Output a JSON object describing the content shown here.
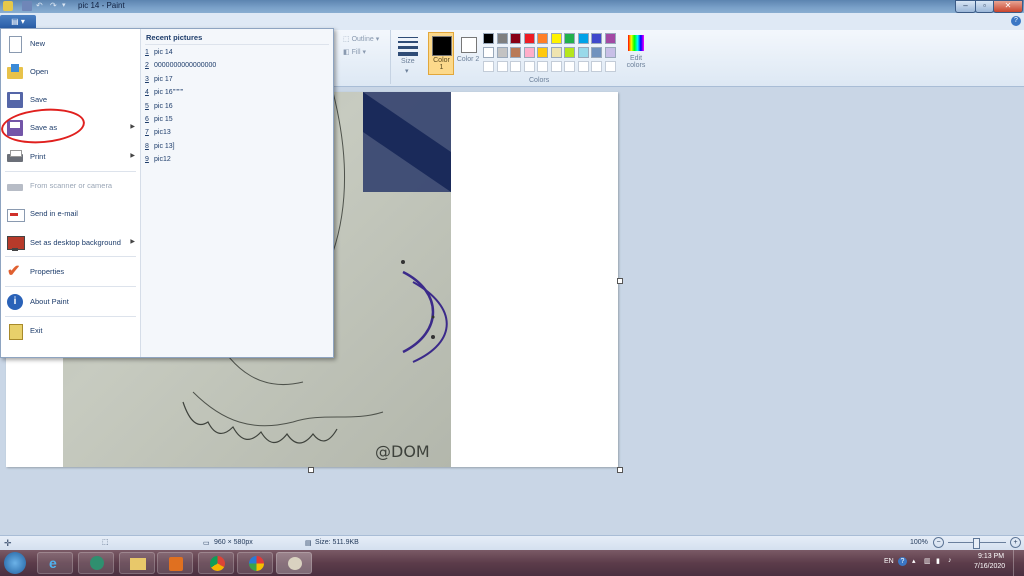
{
  "window": {
    "title": "pic 14 - Paint"
  },
  "ribbon": {
    "outline_label": "Outline",
    "fill_label": "Fill",
    "size_label": "Size",
    "color1_label": "Color 1",
    "color2_label": "Color 2",
    "edit_colors_label": "Edit colors",
    "colors_group_label": "Colors",
    "color1_value": "#000000",
    "color2_value": "#ffffff",
    "palette_row1": [
      "#000000",
      "#7f7f7f",
      "#880015",
      "#ed1c24",
      "#ff7f27",
      "#fff200",
      "#22b14c",
      "#00a2e8",
      "#3f48cc",
      "#a349a4"
    ],
    "palette_row2": [
      "#ffffff",
      "#c3c3c3",
      "#b97a57",
      "#ffaec9",
      "#ffc90e",
      "#efe4b0",
      "#b5e61d",
      "#99d9ea",
      "#7092be",
      "#c8bfe7"
    ]
  },
  "file_menu": {
    "items": [
      {
        "label": "New",
        "icon": "new-document-icon",
        "arrow": false
      },
      {
        "label": "Open",
        "icon": "open-folder-icon",
        "arrow": false
      },
      {
        "label": "Save",
        "icon": "save-disk-icon",
        "arrow": false
      },
      {
        "label": "Save as",
        "icon": "save-as-icon",
        "arrow": true
      },
      {
        "label": "Print",
        "icon": "printer-icon",
        "arrow": true
      },
      {
        "label": "From scanner or camera",
        "icon": "scanner-icon",
        "arrow": false,
        "disabled": true
      },
      {
        "label": "Send in e-mail",
        "icon": "email-icon",
        "arrow": false
      },
      {
        "label": "Set as desktop background",
        "icon": "desktop-background-icon",
        "arrow": true
      },
      {
        "label": "Properties",
        "icon": "checkmark-icon",
        "arrow": false
      },
      {
        "label": "About Paint",
        "icon": "info-icon",
        "arrow": false
      },
      {
        "label": "Exit",
        "icon": "exit-icon",
        "arrow": false
      }
    ],
    "recent_title": "Recent pictures",
    "recent": [
      {
        "n": "1",
        "name": "pic 14"
      },
      {
        "n": "2",
        "name": "0000000000000000"
      },
      {
        "n": "3",
        "name": "pic 17"
      },
      {
        "n": "4",
        "name": "pic 16''''''''"
      },
      {
        "n": "5",
        "name": "pic 16"
      },
      {
        "n": "6",
        "name": "pic 15"
      },
      {
        "n": "7",
        "name": "pic13"
      },
      {
        "n": "8",
        "name": "pic 13]"
      },
      {
        "n": "9",
        "name": "pic12"
      }
    ]
  },
  "drawing": {
    "signature": "@DOM"
  },
  "statusbar": {
    "dimensions": "960 × 580px",
    "size": "Size: 511.9KB",
    "zoom": "100%"
  },
  "taskbar": {
    "language": "EN",
    "time": "9:13 PM",
    "date": "7/16/2020"
  }
}
